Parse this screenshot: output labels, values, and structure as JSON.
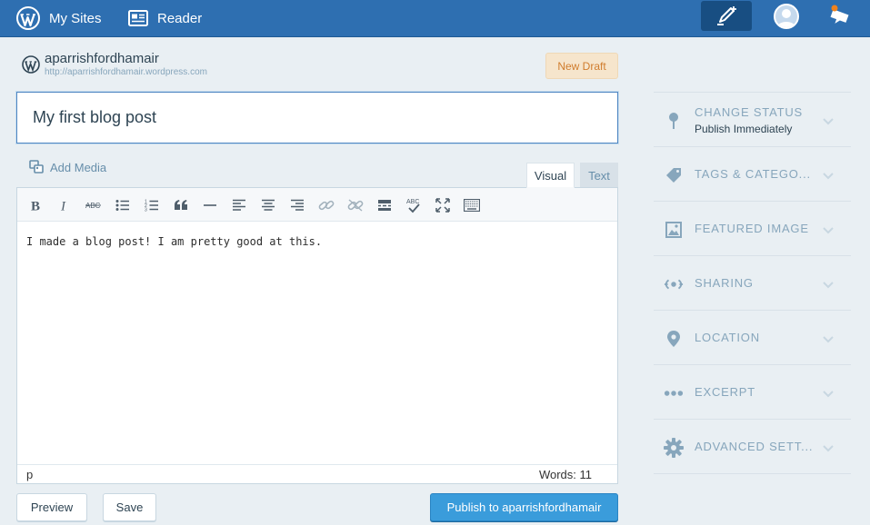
{
  "masterbar": {
    "my_sites": "My Sites",
    "reader": "Reader",
    "icons": [
      "wordpress-icon",
      "reader-icon",
      "write-icon",
      "avatar",
      "notifications-icon"
    ]
  },
  "site": {
    "title": "aparrishfordhamair",
    "url": "http://aparrishfordhamair.wordpress.com",
    "draft_badge": "New Draft"
  },
  "post": {
    "title": "My first blog post",
    "body": "I made a blog post! I am pretty good at this."
  },
  "editor": {
    "add_media": "Add Media",
    "tab_visual": "Visual",
    "tab_text": "Text",
    "status_path": "p",
    "word_count": "Words: 11",
    "toolbar_icons": [
      "bold-icon",
      "italic-icon",
      "strikethrough-icon",
      "bullet-list-icon",
      "numbered-list-icon",
      "blockquote-icon",
      "horizontal-rule-icon",
      "align-left-icon",
      "align-center-icon",
      "align-right-icon",
      "link-icon",
      "unlink-icon",
      "read-more-icon",
      "spellcheck-icon",
      "fullscreen-icon",
      "toolbar-toggle-icon"
    ],
    "abc_label": "ABC"
  },
  "actions": {
    "preview": "Preview",
    "save": "Save",
    "publish": "Publish to aparrishfordhamair"
  },
  "sidebar": {
    "items": [
      {
        "label": "CHANGE STATUS",
        "sub": "Publish Immediately",
        "icon": "pin-icon"
      },
      {
        "label": "TAGS & CATEGO...",
        "icon": "tag-icon"
      },
      {
        "label": "FEATURED IMAGE",
        "icon": "image-icon"
      },
      {
        "label": "SHARING",
        "icon": "sharing-icon"
      },
      {
        "label": "LOCATION",
        "icon": "location-icon"
      },
      {
        "label": "EXCERPT",
        "icon": "ellipsis-icon"
      },
      {
        "label": "ADVANCED SETT...",
        "icon": "gear-icon"
      }
    ]
  },
  "colors": {
    "masterbar": "#2e6fb1",
    "background": "#e9eff3",
    "publish": "#3a9cdb",
    "draft_badge_bg": "#f6e5cc",
    "draft_badge_text": "#d07d2e"
  }
}
